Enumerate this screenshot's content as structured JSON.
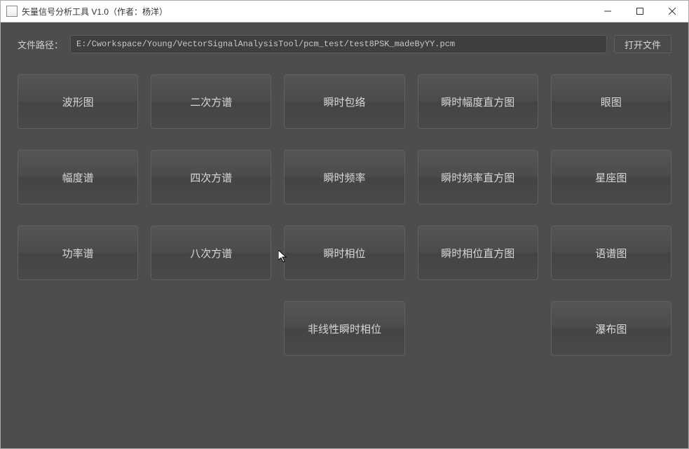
{
  "window": {
    "title": "矢量信号分析工具 V1.0（作者：杨洋）"
  },
  "filepath": {
    "label": "文件路径：",
    "value": "E:/Cworkspace/Young/VectorSignalAnalysisTool/pcm_test/test8PSK_madeByYY.pcm",
    "open_button": "打开文件"
  },
  "grid": {
    "buttons": [
      [
        "波形图",
        "二次方谱",
        "瞬时包络",
        "瞬时幅度直方图",
        "眼图"
      ],
      [
        "幅度谱",
        "四次方谱",
        "瞬时频率",
        "瞬时频率直方图",
        "星座图"
      ],
      [
        "功率谱",
        "八次方谱",
        "瞬时相位",
        "瞬时相位直方图",
        "语谱图"
      ],
      [
        "",
        "",
        "非线性瞬时相位",
        "",
        "瀑布图"
      ]
    ]
  }
}
